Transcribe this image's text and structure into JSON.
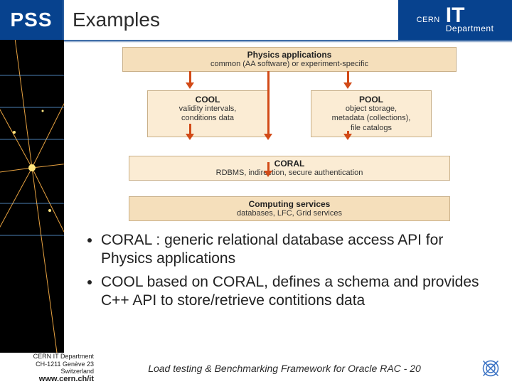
{
  "header": {
    "pss": "PSS",
    "title": "Examples",
    "cern": "CERN",
    "it": "IT",
    "dept": "Department"
  },
  "diagram": {
    "physics": {
      "title": "Physics applications",
      "sub": "common (AA software) or experiment-specific"
    },
    "cool": {
      "title": "COOL",
      "sub": "validity intervals,\nconditions data"
    },
    "pool": {
      "title": "POOL",
      "sub": "object storage,\nmetadata (collections),\nfile catalogs"
    },
    "coral": {
      "title": "CORAL",
      "sub": "RDBMS, indirection, secure authentication"
    },
    "comp": {
      "title": "Computing services",
      "sub": "databases, LFC, Grid services"
    }
  },
  "bullets": {
    "b1": "CORAL : generic relational database access API for Physics applications",
    "b2": "COOL based on CORAL, defines a schema and provides C++ API to store/retrieve contitions data"
  },
  "footer": {
    "org": "CERN IT Department",
    "addr1": "CH-1211 Genève 23",
    "addr2": "Switzerland",
    "url": "www.cern.ch/it",
    "center": "Load testing & Benchmarking Framework for Oracle RAC - 20"
  }
}
